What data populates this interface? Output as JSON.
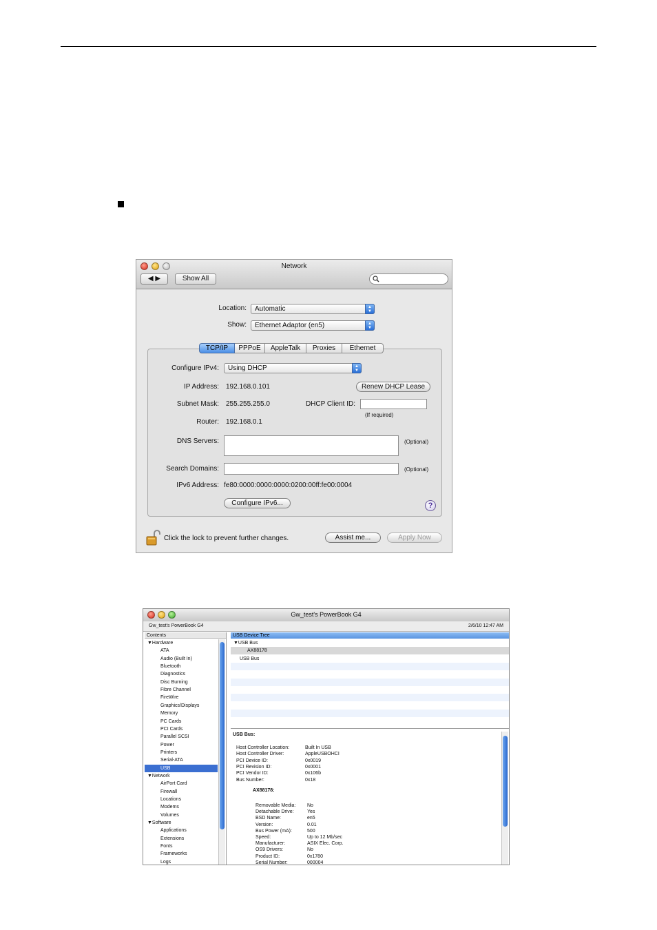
{
  "network_window": {
    "title": "Network",
    "show_all_label": "Show All",
    "location_label": "Location:",
    "location_value": "Automatic",
    "show_label": "Show:",
    "show_value": "Ethernet Adaptor (en5)",
    "tabs": [
      "TCP/IP",
      "PPPoE",
      "AppleTalk",
      "Proxies",
      "Ethernet"
    ],
    "active_tab": "TCP/IP",
    "configure_ipv4_label": "Configure IPv4:",
    "configure_ipv4_value": "Using DHCP",
    "ip_address_label": "IP Address:",
    "ip_address": "192.168.0.101",
    "renew_button": "Renew DHCP Lease",
    "subnet_mask_label": "Subnet Mask:",
    "subnet_mask": "255.255.255.0",
    "dhcp_client_id_label": "DHCP Client ID:",
    "if_required": "(If required)",
    "router_label": "Router:",
    "router": "192.168.0.1",
    "dns_label": "DNS Servers:",
    "optional_1": "(Optional)",
    "search_domains_label": "Search Domains:",
    "optional_2": "(Optional)",
    "ipv6_label": "IPv6 Address:",
    "ipv6_address": "fe80:0000:0000:0000:0200:00ff:fe00:0004",
    "configure_ipv6_button": "Configure IPv6...",
    "help_symbol": "?",
    "lock_text": "Click the lock to prevent further changes.",
    "assist_button": "Assist me...",
    "apply_button": "Apply Now"
  },
  "profiler_window": {
    "title": "Gw_test's PowerBook G4",
    "machine_name": "Gw_test's PowerBook G4",
    "datetime": "2/6/10 12:47 AM",
    "contents_header": "Contents",
    "sidebar": [
      {
        "label": "▼Hardware",
        "level": 0
      },
      {
        "label": "ATA",
        "level": 1
      },
      {
        "label": "Audio (Built In)",
        "level": 1
      },
      {
        "label": "Bluetooth",
        "level": 1
      },
      {
        "label": "Diagnostics",
        "level": 1
      },
      {
        "label": "Disc Burning",
        "level": 1
      },
      {
        "label": "Fibre Channel",
        "level": 1
      },
      {
        "label": "FireWire",
        "level": 1
      },
      {
        "label": "Graphics/Displays",
        "level": 1
      },
      {
        "label": "Memory",
        "level": 1
      },
      {
        "label": "PC Cards",
        "level": 1
      },
      {
        "label": "PCI Cards",
        "level": 1
      },
      {
        "label": "Parallel SCSI",
        "level": 1
      },
      {
        "label": "Power",
        "level": 1
      },
      {
        "label": "Printers",
        "level": 1
      },
      {
        "label": "Serial-ATA",
        "level": 1
      },
      {
        "label": "USB",
        "level": 1,
        "selected": true
      },
      {
        "label": "▼Network",
        "level": 0
      },
      {
        "label": "AirPort Card",
        "level": 1
      },
      {
        "label": "Firewall",
        "level": 1
      },
      {
        "label": "Locations",
        "level": 1
      },
      {
        "label": "Modems",
        "level": 1
      },
      {
        "label": "Volumes",
        "level": 1
      },
      {
        "label": "▼Software",
        "level": 0
      },
      {
        "label": "Applications",
        "level": 1
      },
      {
        "label": "Extensions",
        "level": 1
      },
      {
        "label": "Fonts",
        "level": 1
      },
      {
        "label": "Frameworks",
        "level": 1
      },
      {
        "label": "Logs",
        "level": 1
      }
    ],
    "tree_header": "USB Device Tree",
    "tree_rows": [
      "▼USB Bus",
      "AX88178",
      "USB Bus"
    ],
    "bus_heading": "USB Bus:",
    "bus_props": [
      [
        "Host Controller Location:",
        "Built In USB"
      ],
      [
        "Host Controller Driver:",
        "AppleUSBOHCI"
      ],
      [
        "PCI Device ID:",
        "0x0019"
      ],
      [
        "PCI Revision ID:",
        "0x0001"
      ],
      [
        "PCI Vendor ID:",
        "0x106b"
      ],
      [
        "Bus Number:",
        "0x18"
      ]
    ],
    "device_heading": "AX88178:",
    "device_props": [
      [
        "Removable Media:",
        "No"
      ],
      [
        "Detachable Drive:",
        "Yes"
      ],
      [
        "BSD Name:",
        "en5"
      ],
      [
        "Version:",
        "0.01"
      ],
      [
        "Bus Power (mA):",
        "500"
      ],
      [
        "Speed:",
        "Up to 12 Mb/sec"
      ],
      [
        "Manufacturer:",
        "ASIX Elec. Corp."
      ],
      [
        "OS9 Drivers:",
        "No"
      ],
      [
        "Product ID:",
        "0x1780"
      ],
      [
        "Serial Number:",
        "000004"
      ]
    ]
  }
}
